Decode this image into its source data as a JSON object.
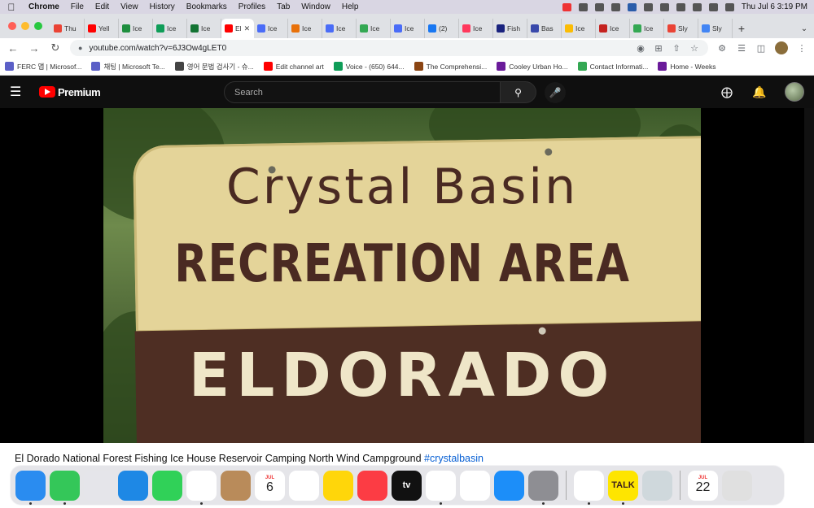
{
  "menubar": {
    "items": [
      "Chrome",
      "File",
      "Edit",
      "View",
      "History",
      "Bookmarks",
      "Profiles",
      "Tab",
      "Window",
      "Help"
    ],
    "clock": "Thu Jul 6  3:19 PM"
  },
  "tabs": [
    {
      "label": "Thu",
      "color": "#ea4335"
    },
    {
      "label": "Yell",
      "color": "#ff0000"
    },
    {
      "label": "Ice",
      "color": "#1e8e3e"
    },
    {
      "label": "Ice",
      "color": "#0f9d58"
    },
    {
      "label": "Ice",
      "color": "#137333"
    },
    {
      "label": "El",
      "color": "#ff0000",
      "active": true
    },
    {
      "label": "Ice",
      "color": "#4a6cf7"
    },
    {
      "label": "Ice",
      "color": "#e8710a"
    },
    {
      "label": "Ice",
      "color": "#4a6cf7"
    },
    {
      "label": "Ice",
      "color": "#34a853"
    },
    {
      "label": "Ice",
      "color": "#4a6cf7"
    },
    {
      "label": "(2)",
      "color": "#1877f2"
    },
    {
      "label": "Ice",
      "color": "#ff385c"
    },
    {
      "label": "Fish",
      "color": "#1a237e"
    },
    {
      "label": "Bas",
      "color": "#3949ab"
    },
    {
      "label": "Ice",
      "color": "#fbbc04"
    },
    {
      "label": "Ice",
      "color": "#c5221f"
    },
    {
      "label": "Ice",
      "color": "#34a853"
    },
    {
      "label": "Sly",
      "color": "#ea4335"
    },
    {
      "label": "Sly",
      "color": "#4285f4"
    }
  ],
  "address": {
    "url": "youtube.com/watch?v=6J3Ow4gLET0"
  },
  "bookmarks": [
    {
      "label": "FERC 앱 | Microsof...",
      "color": "#5b5fc7"
    },
    {
      "label": "채팅 | Microsoft Te...",
      "color": "#5b5fc7"
    },
    {
      "label": "영어 문법 검사기 - 슈...",
      "color": "#444444"
    },
    {
      "label": "Edit channel art",
      "color": "#ff0000"
    },
    {
      "label": "Voice - (650) 644...",
      "color": "#0f9d58"
    },
    {
      "label": "The Comprehensi...",
      "color": "#8b4513"
    },
    {
      "label": "Cooley Urban Ho...",
      "color": "#6a1b9a"
    },
    {
      "label": "Contact Informati...",
      "color": "#34a853"
    },
    {
      "label": "Home - Weeks",
      "color": "#6a1b9a"
    }
  ],
  "youtube": {
    "logo_text": "Premium",
    "search_placeholder": "Search"
  },
  "video": {
    "sign_line1": "Crystal Basin",
    "sign_line2": "RECREATION AREA",
    "sign_line3": "ELDORADO"
  },
  "video_title": {
    "text": "El Dorado National Forest Fishing Ice House Reservoir Camping North Wind Campground ",
    "hashtag": "#crystalbasin"
  },
  "dock": {
    "apps": [
      {
        "name": "finder",
        "label": "",
        "color": "#2a8cf0"
      },
      {
        "name": "messages",
        "label": "",
        "color": "#34c759"
      },
      {
        "name": "launchpad",
        "label": "",
        "color": "#e5e5ea"
      },
      {
        "name": "mail",
        "label": "",
        "color": "#1e88e5"
      },
      {
        "name": "facetime",
        "label": "",
        "color": "#30d158"
      },
      {
        "name": "photos",
        "label": "",
        "color": "#ffffff"
      },
      {
        "name": "contacts",
        "label": "",
        "color": "#b98b5a"
      },
      {
        "name": "calendar",
        "month": "JUL",
        "day": "6"
      },
      {
        "name": "reminders",
        "label": "",
        "color": "#ffffff"
      },
      {
        "name": "notes",
        "label": "",
        "color": "#ffd60a"
      },
      {
        "name": "music",
        "label": "",
        "color": "#fc3c44"
      },
      {
        "name": "tv",
        "label": "tv",
        "color": "#111111"
      },
      {
        "name": "chrome",
        "label": "",
        "color": "#ffffff"
      },
      {
        "name": "news",
        "label": "",
        "color": "#ffffff"
      },
      {
        "name": "app-store",
        "label": "",
        "color": "#1c8ef9"
      },
      {
        "name": "system-settings",
        "label": "",
        "color": "#8e8e93"
      },
      {
        "name": "cursor-app",
        "label": "",
        "color": "#ffffff"
      },
      {
        "name": "kakaotalk",
        "label": "TALK",
        "color": "#fee500"
      },
      {
        "name": "preview",
        "label": "",
        "color": "#cfd8dc"
      },
      {
        "name": "calendar-2",
        "month": "JUL",
        "day": "22"
      },
      {
        "name": "trash",
        "label": "",
        "color": "#e0e0e0"
      }
    ]
  }
}
